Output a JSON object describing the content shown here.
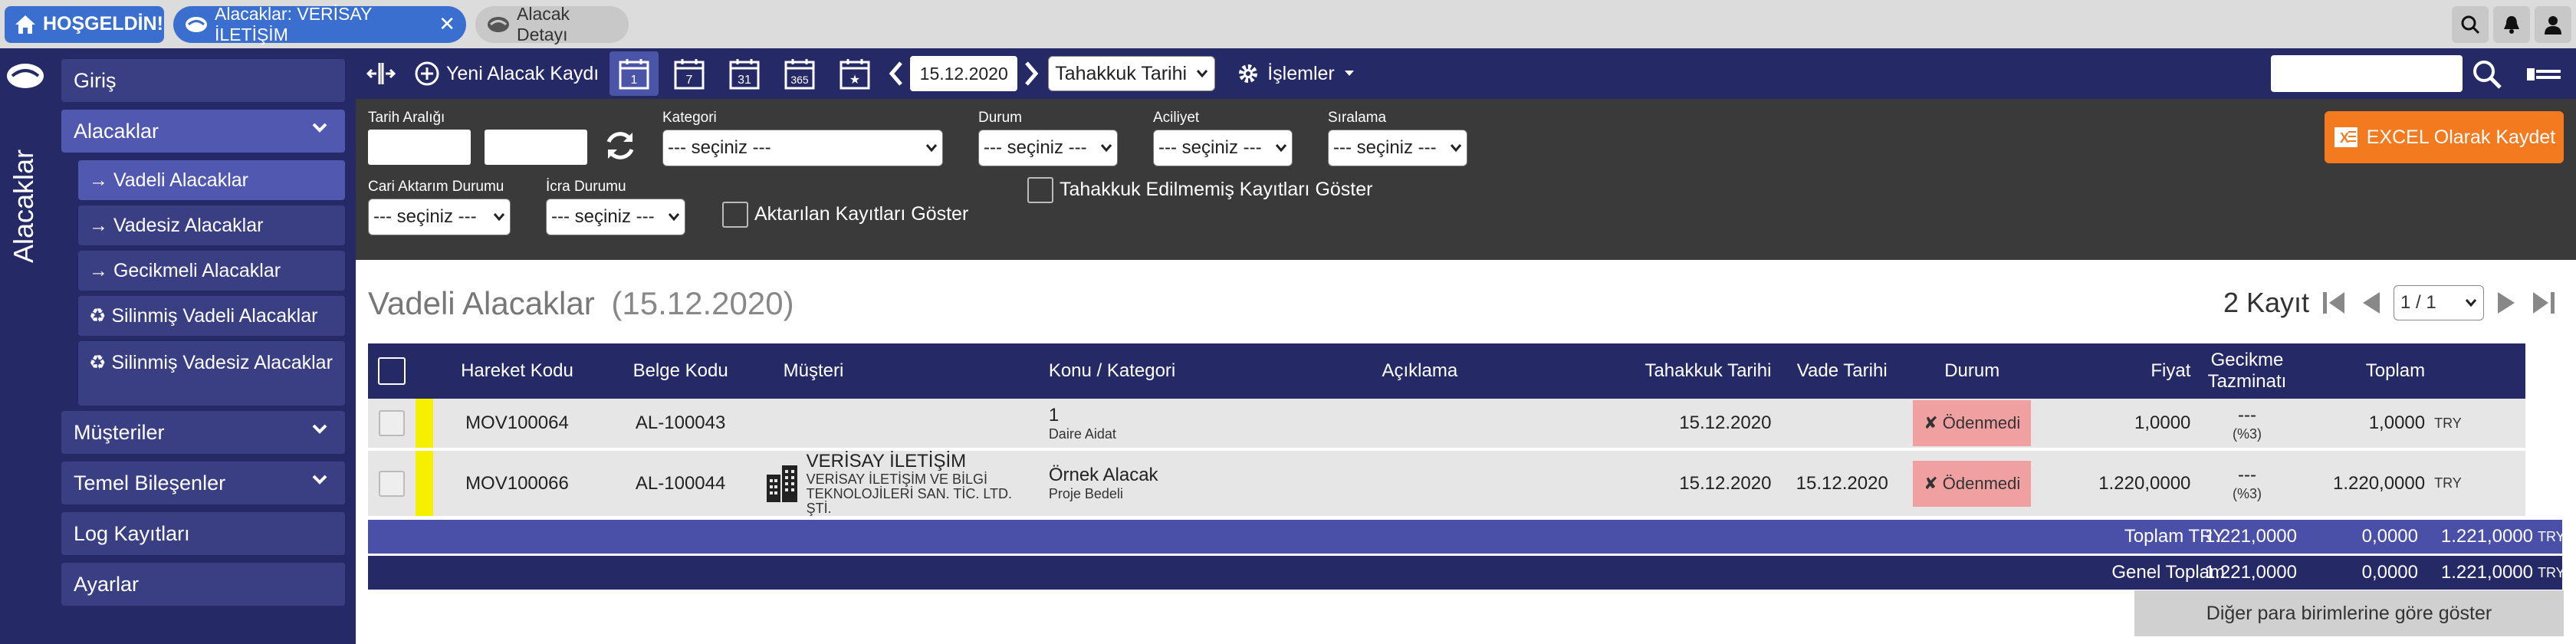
{
  "topbar": {
    "home_label": "HOŞGELDİN!",
    "tabs": [
      {
        "label": "Alacaklar: VERİSAY İLETİŞİM",
        "active": true
      },
      {
        "label": "Alacak Detayı",
        "active": false
      }
    ],
    "icons": [
      "search-icon",
      "bell-icon",
      "user-icon"
    ]
  },
  "rail": {
    "title": "Alacaklar"
  },
  "sidebar": {
    "items": [
      {
        "label": "Giriş"
      },
      {
        "label": "Alacaklar",
        "open": true
      },
      {
        "label": "Müşteriler"
      },
      {
        "label": "Temel Bileşenler"
      },
      {
        "label": "Log Kayıtları"
      },
      {
        "label": "Ayarlar"
      }
    ],
    "subitems": [
      {
        "label": "→ Vadeli Alacaklar",
        "active": true
      },
      {
        "label": "→ Vadesiz Alacaklar"
      },
      {
        "label": "→ Gecikmeli Alacaklar"
      },
      {
        "label": "♻ Silinmiş Vadeli Alacaklar"
      },
      {
        "label": "♻ Silinmiş Vadesiz Alacaklar"
      }
    ]
  },
  "toolbar": {
    "new_label": "Yeni Alacak Kaydı",
    "cal_buttons": [
      "1",
      "7",
      "31",
      "365",
      "★"
    ],
    "date_value": "15.12.2020",
    "date_type": "Tahakkuk Tarihi",
    "actions_label": "İşlemler"
  },
  "filters": {
    "tarih_label": "Tarih Aralığı",
    "kategori_label": "Kategori",
    "kategori_value": "--- seçiniz ---",
    "durum_label": "Durum",
    "durum_value": "--- seçiniz ---",
    "aciliyet_label": "Aciliyet",
    "aciliyet_value": "--- seçiniz ---",
    "siralama_label": "Sıralama",
    "siralama_value": "--- seçiniz ---",
    "cari_label": "Cari Aktarım Durumu",
    "cari_value": "--- seçiniz ---",
    "icra_label": "İcra Durumu",
    "icra_value": "--- seçiniz ---",
    "aktarilan_label": "Aktarılan Kayıtları Göster",
    "tahakkuk_label": "Tahakkuk Edilmemiş Kayıtları Göster",
    "excel_label": "EXCEL Olarak Kaydet"
  },
  "page": {
    "title": "Vadeli Alacaklar",
    "title_date": "(15.12.2020)",
    "record_count": "2 Kayıt",
    "page_value": "1 / 1"
  },
  "table": {
    "headers": [
      "Hareket Kodu",
      "Belge Kodu",
      "Müşteri",
      "Konu / Kategori",
      "Açıklama",
      "Tahakkuk Tarihi",
      "Vade Tarihi",
      "Durum",
      "Fiyat",
      "Gecikme Tazminatı",
      "Toplam"
    ],
    "rows": [
      {
        "hareket": "MOV100064",
        "belge": "AL-100043",
        "musteri": "",
        "musteri_sub": "",
        "konu": "1",
        "kategori": "Daire Aidat",
        "aciklama": "",
        "tahakkuk": "15.12.2020",
        "vade": "",
        "durum": "✘ Ödenmedi",
        "fiyat": "1,0000",
        "gecikme": "---",
        "gecikme_sub": "(%3)",
        "toplam": "1,0000",
        "currency": "TRY"
      },
      {
        "hareket": "MOV100066",
        "belge": "AL-100044",
        "musteri": "VERİSAY İLETİŞİM",
        "musteri_sub": "VERİSAY İLETİŞİM VE BİLGİ TEKNOLOJİLERİ SAN. TİC. LTD. ŞTİ.",
        "konu": "Örnek Alacak",
        "kategori": "Proje Bedeli",
        "aciklama": "",
        "tahakkuk": "15.12.2020",
        "vade": "15.12.2020",
        "durum": "✘ Ödenmedi",
        "fiyat": "1.220,0000",
        "gecikme": "---",
        "gecikme_sub": "(%3)",
        "toplam": "1.220,0000",
        "currency": "TRY"
      }
    ]
  },
  "totals": {
    "try_label": "Toplam TRY",
    "try_fiyat": "1.221,0000",
    "try_gecikme": "0,0000",
    "try_toplam": "1.221,0000",
    "try_cur": "TRY",
    "genel_label": "Genel Toplam",
    "genel_fiyat": "1.221,0000",
    "genel_gecikme": "0,0000",
    "genel_toplam": "1.221,0000",
    "genel_cur": "TRY"
  },
  "other_currency_label": "Diğer para birimlerine göre göster",
  "colors": {
    "navy": "#252a66",
    "accent": "#3a6fd0",
    "excel": "#f47a20",
    "unpaid": "#f0a0a0",
    "flag": "#f6f000"
  }
}
